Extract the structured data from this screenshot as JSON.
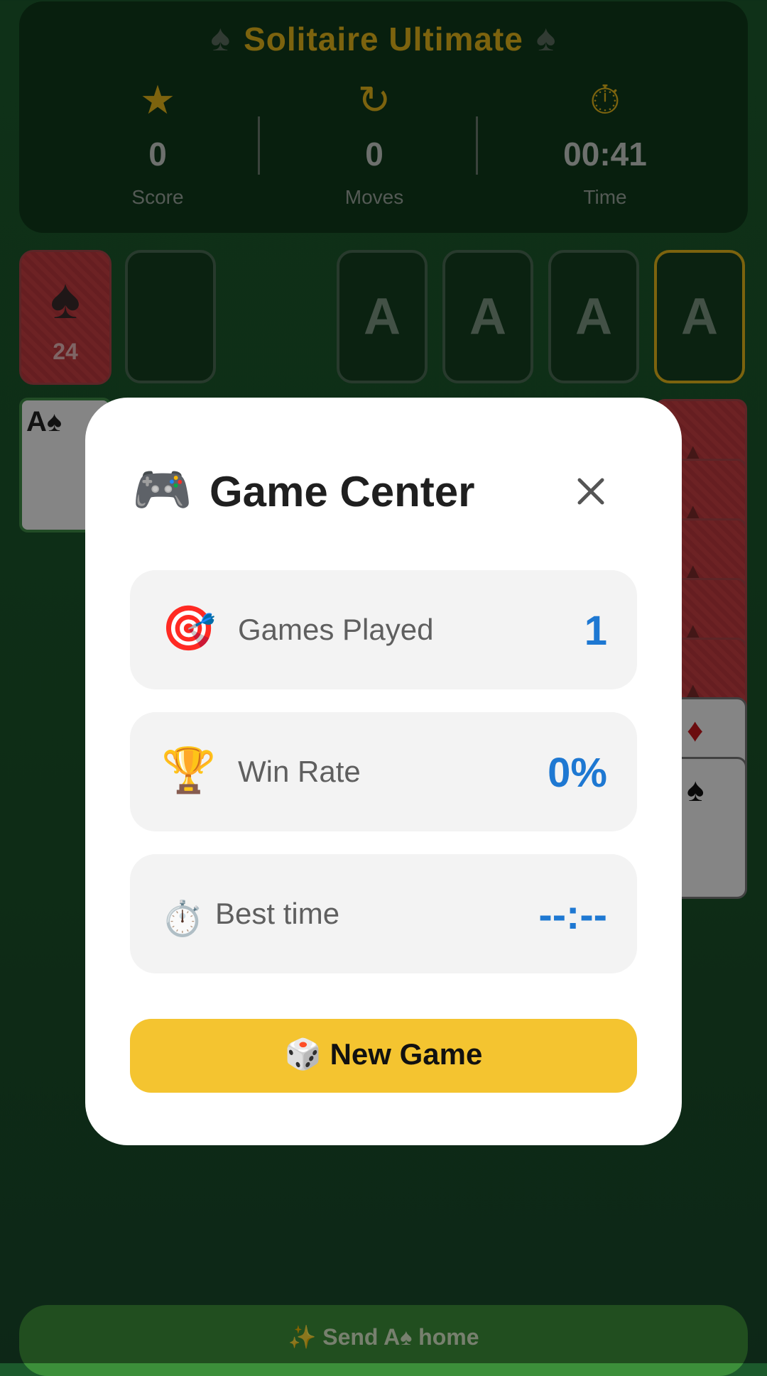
{
  "header": {
    "title": "Solitaire Ultimate",
    "title_icon": "♠",
    "stats": [
      {
        "icon": "★",
        "icon_name": "star-icon",
        "value": "0",
        "label": "Score"
      },
      {
        "icon": "↻",
        "icon_name": "refresh-icon",
        "value": "0",
        "label": "Moves"
      },
      {
        "icon": "⏱",
        "icon_name": "stopwatch-icon",
        "value": "00:41",
        "label": "Time"
      }
    ]
  },
  "table": {
    "stock_suit": "♠",
    "stock_count": "24",
    "foundations": [
      "A",
      "A",
      "A",
      "A"
    ],
    "tableau_card": "A♠",
    "right_card_suits": [
      "♦",
      "♠"
    ]
  },
  "modal": {
    "icon": "🎮",
    "title": "Game Center",
    "close_icon": "×",
    "rows": [
      {
        "icon": "🎯",
        "label": "Games Played",
        "value": "1"
      },
      {
        "icon": "🏆",
        "label": "Win Rate",
        "value": "0%"
      },
      {
        "icon": "⏱️",
        "label": "Best time",
        "value": "--:--"
      }
    ],
    "new_game_label": "🎲 New Game"
  },
  "bottom_bar": {
    "label": "✨ Send A♠ home"
  },
  "colors": {
    "gold": "#e2b51b",
    "accent_blue": "#1e78d2",
    "button_yellow": "#f4c430"
  }
}
